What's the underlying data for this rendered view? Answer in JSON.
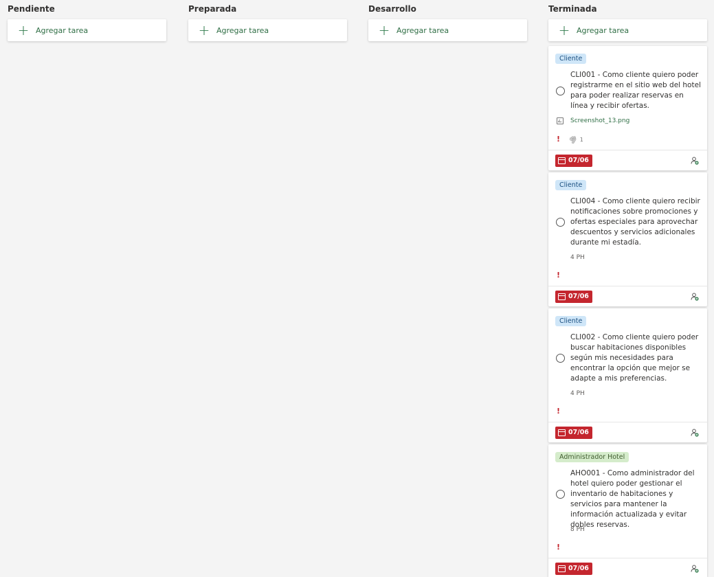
{
  "columns": [
    {
      "title": "Pendiente",
      "add_label": "Agregar tarea"
    },
    {
      "title": "Preparada",
      "add_label": "Agregar tarea"
    },
    {
      "title": "Desarrollo",
      "add_label": "Agregar tarea"
    },
    {
      "title": "Terminada",
      "add_label": "Agregar tarea"
    }
  ],
  "cards": [
    {
      "tag": "Cliente",
      "title": "CLI001 - Como cliente quiero poder registrarme en el sitio web del hotel para poder realizar reservas en línea y recibir ofertas.",
      "attachment": "Screenshot_13.png",
      "attachment_count": "1",
      "due": "07/06"
    },
    {
      "tag": "Cliente",
      "title": "CLI004 - Como cliente quiero recibir notificaciones sobre promociones y ofertas especiales para aprovechar descuentos y servicios adicionales durante mi estadía.",
      "estimate": "4 PH",
      "due": "07/06"
    },
    {
      "tag": "Cliente",
      "title": "CLI002 - Como cliente quiero poder buscar habitaciones disponibles según mis necesidades para encontrar la opción que mejor se adapte a mis preferencias.",
      "estimate": "4 PH",
      "due": "07/06"
    },
    {
      "tag": "Administrador Hotel",
      "title": "AHO001 - Como administrador del hotel quiero poder gestionar el inventario de habitaciones y servicios para mantener la información actualizada y evitar dobles reservas.",
      "estimate": "8 PH",
      "due": "07/06"
    }
  ],
  "icons": {
    "add": "plus-icon",
    "priority": "exclamation-icon",
    "attachment": "paperclip-icon",
    "file": "image-file-icon",
    "due": "calendar-icon",
    "assign": "assign-user-icon"
  },
  "colors": {
    "accent": "#2f7a4b",
    "due_badge": "#c4262e",
    "tag_client": "#cfe6f8",
    "tag_admin": "#d5eccb"
  }
}
